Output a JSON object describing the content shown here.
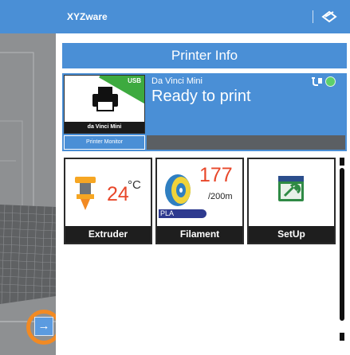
{
  "app": {
    "title": "XYZware"
  },
  "panel": {
    "header": "Printer Info"
  },
  "printer": {
    "connection_badge": "USB",
    "model_label": "da Vinci Mini",
    "name": "Da Vinci Mini",
    "status": "Ready to print",
    "status_color": "#5dd06b",
    "monitor_button": "Printer Monitor"
  },
  "tiles": {
    "extruder": {
      "label": "Extruder",
      "temperature": "24",
      "unit": "°C"
    },
    "filament": {
      "label": "Filament",
      "remaining": "177",
      "total": "/200m",
      "type": "PLA"
    },
    "setup": {
      "label": "SetUp"
    }
  },
  "sidebar_toggle": {
    "icon": "arrow-right-icon"
  },
  "colors": {
    "accent": "#4a8fd6",
    "highlight": "#f28a23",
    "temp": "#e8472a"
  }
}
